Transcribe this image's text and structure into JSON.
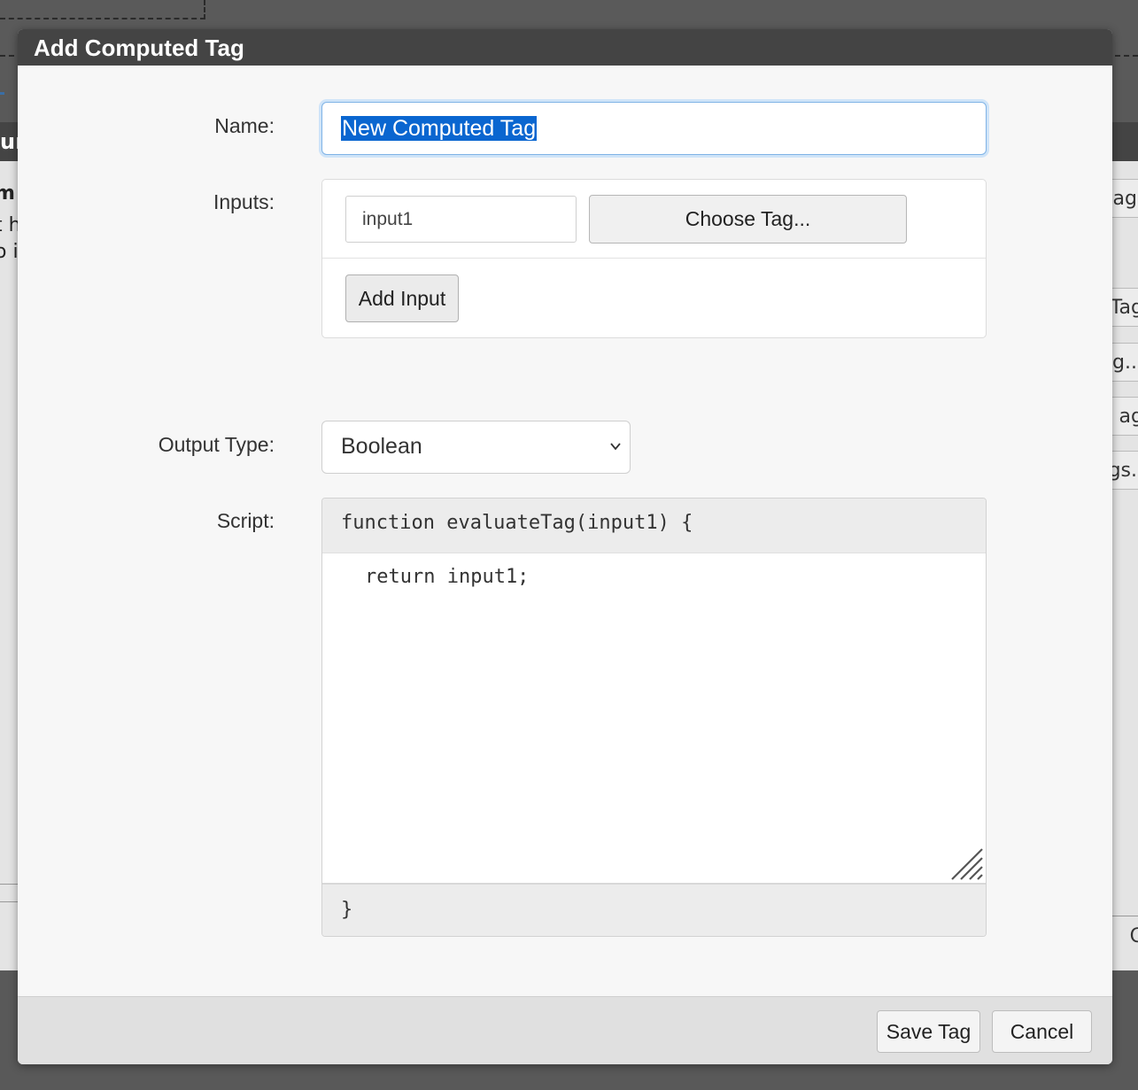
{
  "background": {
    "panel_right_items": [
      "ag.",
      "Tag",
      "g...",
      "ag",
      "gs.."
    ],
    "panel_left_lines": [
      "m",
      "t h",
      "o i"
    ],
    "panel_header_fragment": "ur",
    "bottom_right_fragment": "C"
  },
  "dialog": {
    "title": "Add Computed Tag",
    "name": {
      "label": "Name:",
      "value": "New Computed Tag"
    },
    "inputs": {
      "label": "Inputs:",
      "items": [
        {
          "name": "input1",
          "choose_button": "Choose Tag..."
        }
      ],
      "add_button": "Add Input"
    },
    "output_type": {
      "label": "Output Type:",
      "selected": "Boolean"
    },
    "script": {
      "label": "Script:",
      "header": "function evaluateTag(input1) {",
      "body": "return input1;",
      "footer": "}"
    },
    "footer": {
      "save_button": "Save Tag",
      "cancel_button": "Cancel"
    }
  }
}
